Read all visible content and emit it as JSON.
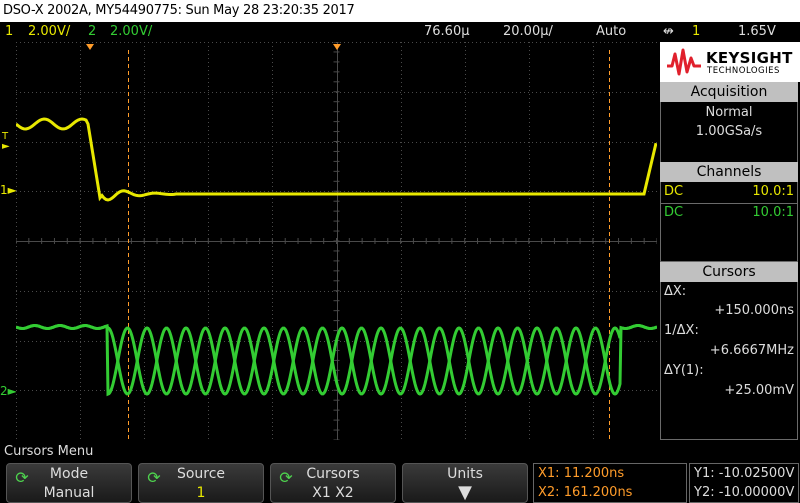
{
  "title_bar": {
    "text": "DSO-X 2002A, MY54490775: Sun May 28 23:20:35 2017"
  },
  "status_bar": {
    "ch1_num": "1",
    "ch1_scale": "2.00V/",
    "ch2_num": "2",
    "ch2_scale": "2.00V/",
    "delay": "76.60µ",
    "timebase": "20.00µ/",
    "trigger_mode": "Auto",
    "trigger_icon": "↮",
    "trigger_source": "1",
    "trigger_level": "1.65V"
  },
  "brand": {
    "name": "KEYSIGHT",
    "sub": "TECHNOLOGIES",
    "logo_color": "#e0202c"
  },
  "acquisition": {
    "header": "Acquisition",
    "mode": "Normal",
    "rate": "1.00GSa/s"
  },
  "channels": {
    "header": "Channels",
    "rows": [
      {
        "coupling": "DC",
        "probe": "10.0:1",
        "color": "#e8e800"
      },
      {
        "coupling": "DC",
        "probe": "10.0:1",
        "color": "#33cc33"
      }
    ]
  },
  "cursors": {
    "header": "Cursors",
    "dx_label": "ΔX:",
    "dx_value": "+150.000ns",
    "inv_dx_label": "1/ΔX:",
    "inv_dx_value": "+6.6667MHz",
    "dy_label": "ΔY(1):",
    "dy_value": "+25.00mV"
  },
  "menu_title": "Cursors Menu",
  "softkeys": [
    {
      "label": "Mode",
      "value": "Manual",
      "icon": "rotary-knob-icon"
    },
    {
      "label": "Source",
      "value": "1",
      "icon": "rotary-knob-icon"
    },
    {
      "label": "Cursors",
      "value": "X1 X2",
      "icon": "rotary-knob-icon"
    },
    {
      "label": "Units",
      "value": "▼",
      "icon": "down-arrow-icon"
    }
  ],
  "cursor_readout": {
    "x1": "X1: 11.200ns",
    "x2": "X2: 161.200ns",
    "y1": "Y1: -10.02500V",
    "y2": "Y2: -10.00000V"
  },
  "marker_labels": {
    "trig": "T",
    "ch1": "1",
    "ch2": "2"
  },
  "colors": {
    "ch1": "#e8e800",
    "ch2": "#33cc33",
    "cursor": "#ff9c2a",
    "grid": "#4a4a4a"
  }
}
